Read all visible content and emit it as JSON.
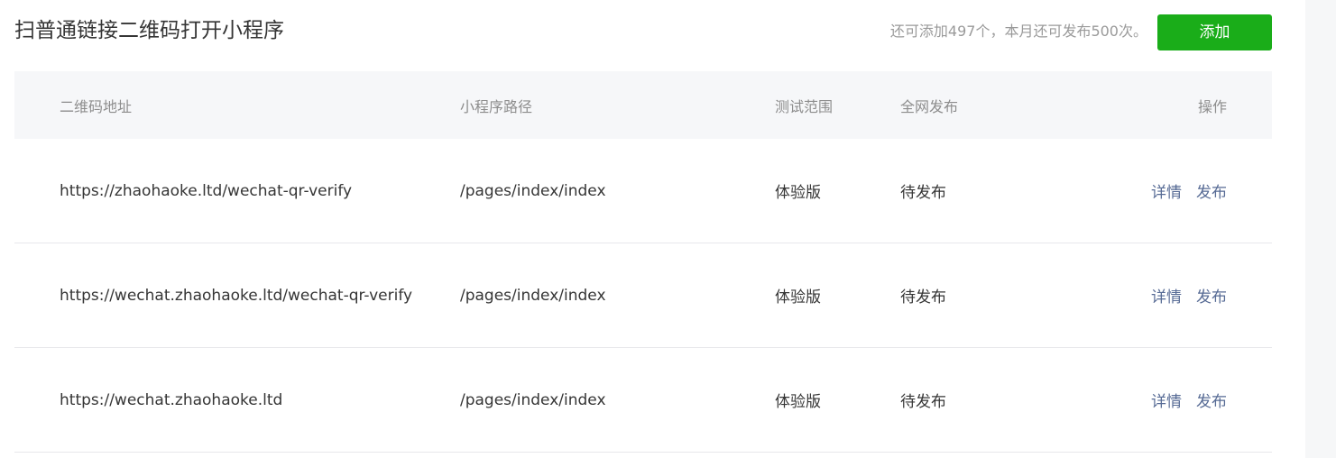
{
  "header": {
    "title": "扫普通链接二维码打开小程序",
    "quota_text": "还可添加497个，本月还可发布500次。",
    "add_button_label": "添加"
  },
  "table": {
    "columns": [
      "二维码地址",
      "小程序路径",
      "测试范围",
      "全网发布",
      "操作"
    ],
    "rows": [
      {
        "url": "https://zhaohaoke.ltd/wechat-qr-verify",
        "path": "/pages/index/index",
        "scope": "体验版",
        "publish": "待发布",
        "actions": [
          "详情",
          "发布"
        ]
      },
      {
        "url": "https://wechat.zhaohaoke.ltd/wechat-qr-verify",
        "path": "/pages/index/index",
        "scope": "体验版",
        "publish": "待发布",
        "actions": [
          "详情",
          "发布"
        ]
      },
      {
        "url": "https://wechat.zhaohaoke.ltd",
        "path": "/pages/index/index",
        "scope": "体验版",
        "publish": "待发布",
        "actions": [
          "详情",
          "发布"
        ]
      }
    ]
  },
  "colors": {
    "primary_button": "#1aad19",
    "link": "#576b95",
    "header_bg": "#f6f7f9"
  }
}
